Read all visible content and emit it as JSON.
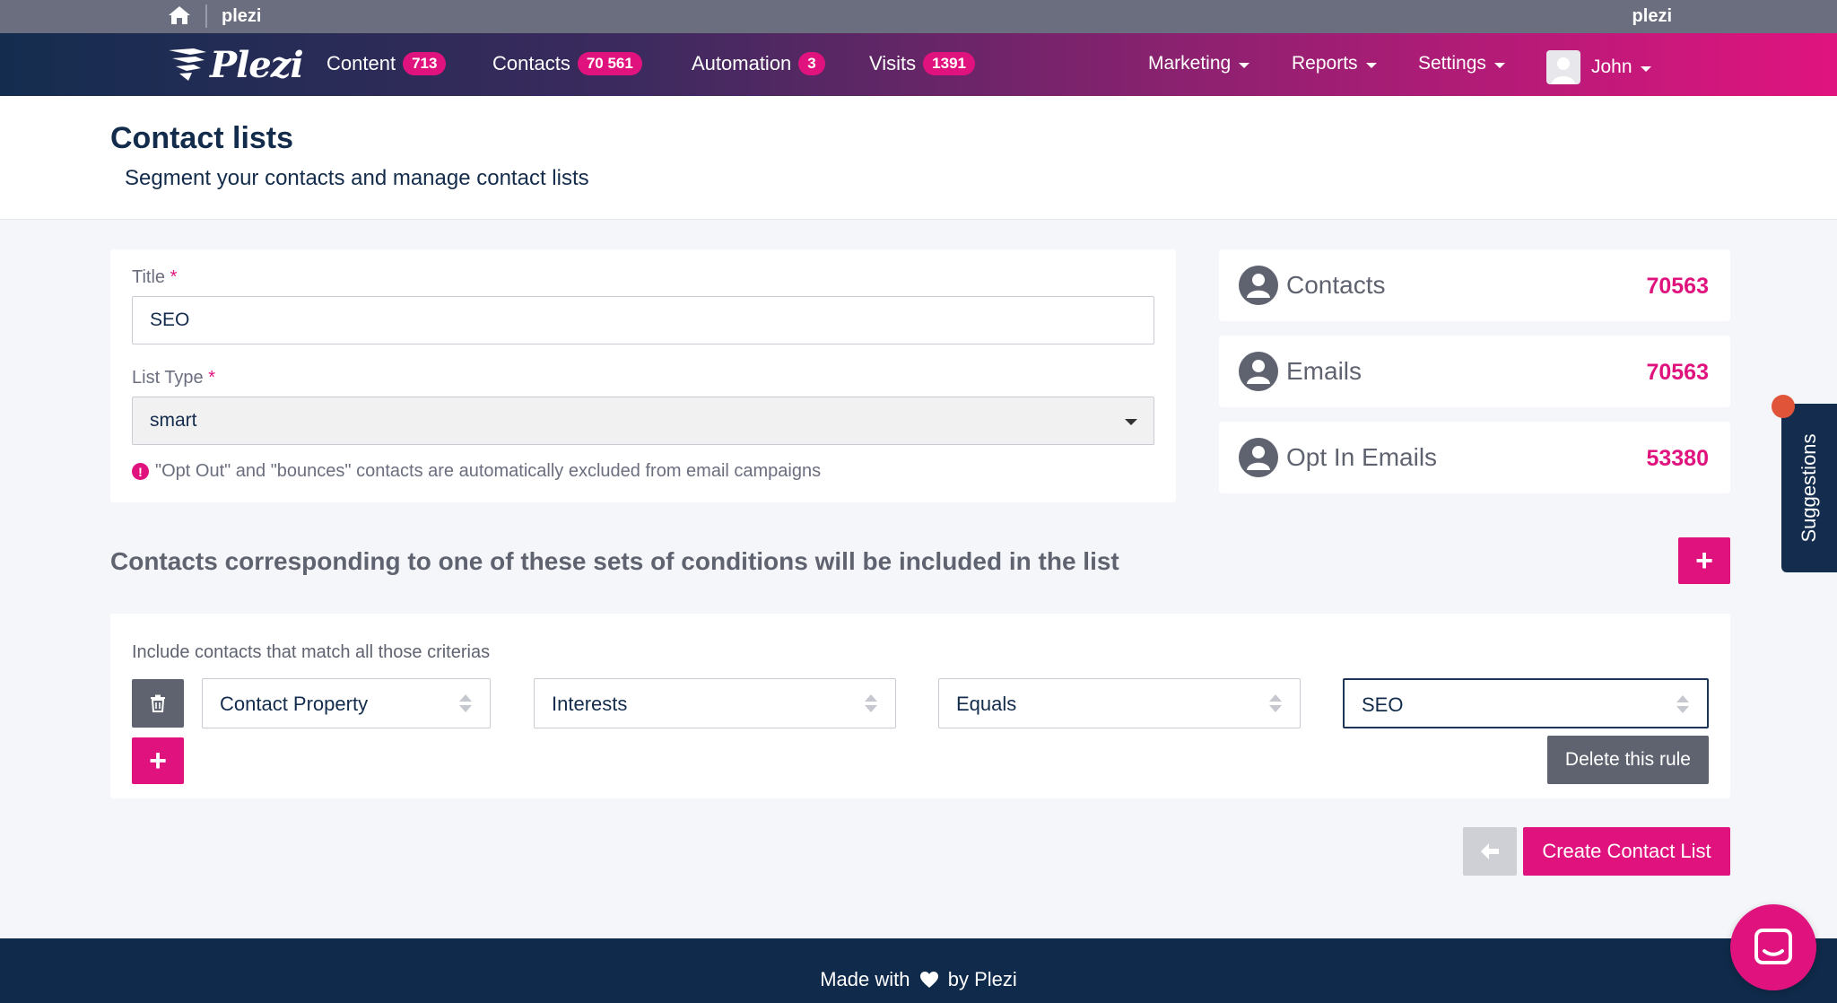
{
  "topbar": {
    "brand_left": "plezi",
    "brand_right": "plezi"
  },
  "nav": {
    "logo_text": "Plezi",
    "items": [
      {
        "label": "Content",
        "count": "713"
      },
      {
        "label": "Contacts",
        "count": "70 561"
      },
      {
        "label": "Automation",
        "count": "3"
      },
      {
        "label": "Visits",
        "count": "1391"
      }
    ],
    "menus": {
      "marketing": "Marketing",
      "reports": "Reports",
      "settings": "Settings"
    },
    "user": "John"
  },
  "header": {
    "title": "Contact lists",
    "subtitle": "Segment your contacts and manage contact lists"
  },
  "form": {
    "title_label": "Title",
    "title_value": "SEO",
    "list_type_label": "List Type",
    "list_type_value": "smart",
    "required_mark": "*",
    "warning_icon": "!",
    "warning": "\"Opt Out\" and \"bounces\" contacts are automatically excluded from email campaigns"
  },
  "stats": [
    {
      "label": "Contacts",
      "value": "70563"
    },
    {
      "label": "Emails",
      "value": "70563"
    },
    {
      "label": "Opt In Emails",
      "value": "53380"
    }
  ],
  "conditions": {
    "title": "Contacts corresponding to one of these sets of conditions will be included in the list",
    "add_set_label": "+",
    "include_text": "Include contacts that match all those criterias",
    "rule": {
      "field": "Contact Property",
      "property": "Interests",
      "operator": "Equals",
      "value": "SEO"
    },
    "add_rule_label": "+",
    "delete_rule_label": "Delete this rule"
  },
  "actions": {
    "create_label": "Create Contact List"
  },
  "suggestions": {
    "label": "Suggestions"
  },
  "footer": {
    "made_with": "Made with",
    "by": "by Plezi"
  },
  "colors": {
    "accent": "#e0137e",
    "navy": "#142d4f",
    "grey": "#5f6370"
  },
  "icons": [
    "home-icon",
    "plezi-logo-icon",
    "user-icon",
    "trash-icon",
    "arrow-left-icon",
    "heart-icon",
    "chat-icon",
    "caret-down-icon",
    "exclamation-icon"
  ]
}
